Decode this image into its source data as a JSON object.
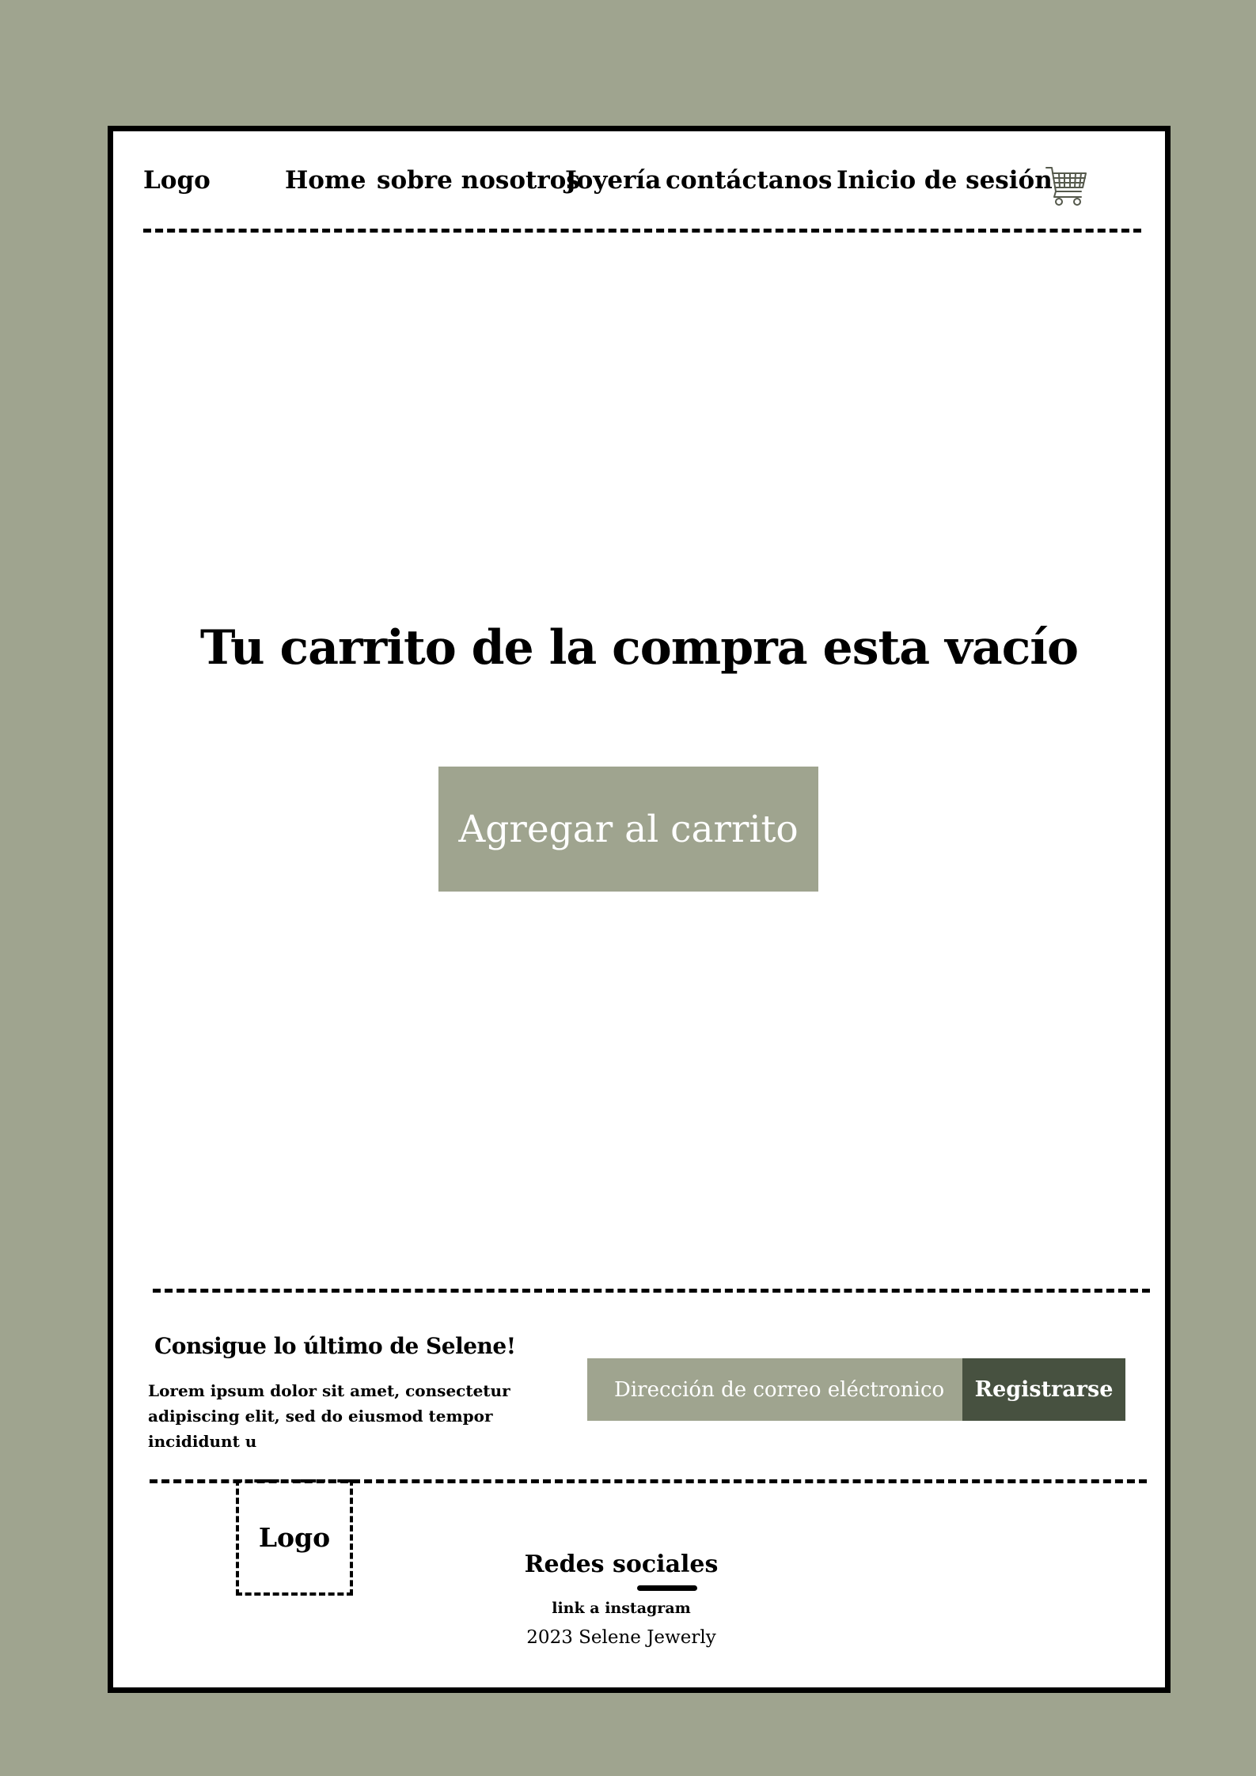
{
  "header": {
    "logo": "Logo",
    "nav": [
      {
        "label": "Home"
      },
      {
        "label": "sobre nosotros"
      },
      {
        "label": "Joyería"
      },
      {
        "label": "contáctanos"
      },
      {
        "label": "Inicio de sesión"
      }
    ],
    "cart_icon": "shopping-cart-icon"
  },
  "main": {
    "title": "Tu carrito de la compra esta vacío",
    "add_to_cart_label": "Agregar al carrito"
  },
  "newsletter": {
    "heading": "Consigue lo último de Selene!",
    "body": "Lorem ipsum dolor sit amet, consectetur adipiscing elit, sed do eiusmod tempor incididunt u",
    "email_placeholder": "Dirección de correo eléctronico",
    "register_label": "Registrarse"
  },
  "footer": {
    "logo": "Logo",
    "social_heading": "Redes sociales",
    "instagram_link": "link a instagram",
    "copyright": "2023 Selene Jewerly"
  },
  "colors": {
    "background": "#9fa48f",
    "accent_button": "#9fa48f",
    "dark_button": "#475140",
    "surface": "#ffffff",
    "text": "#000000"
  }
}
